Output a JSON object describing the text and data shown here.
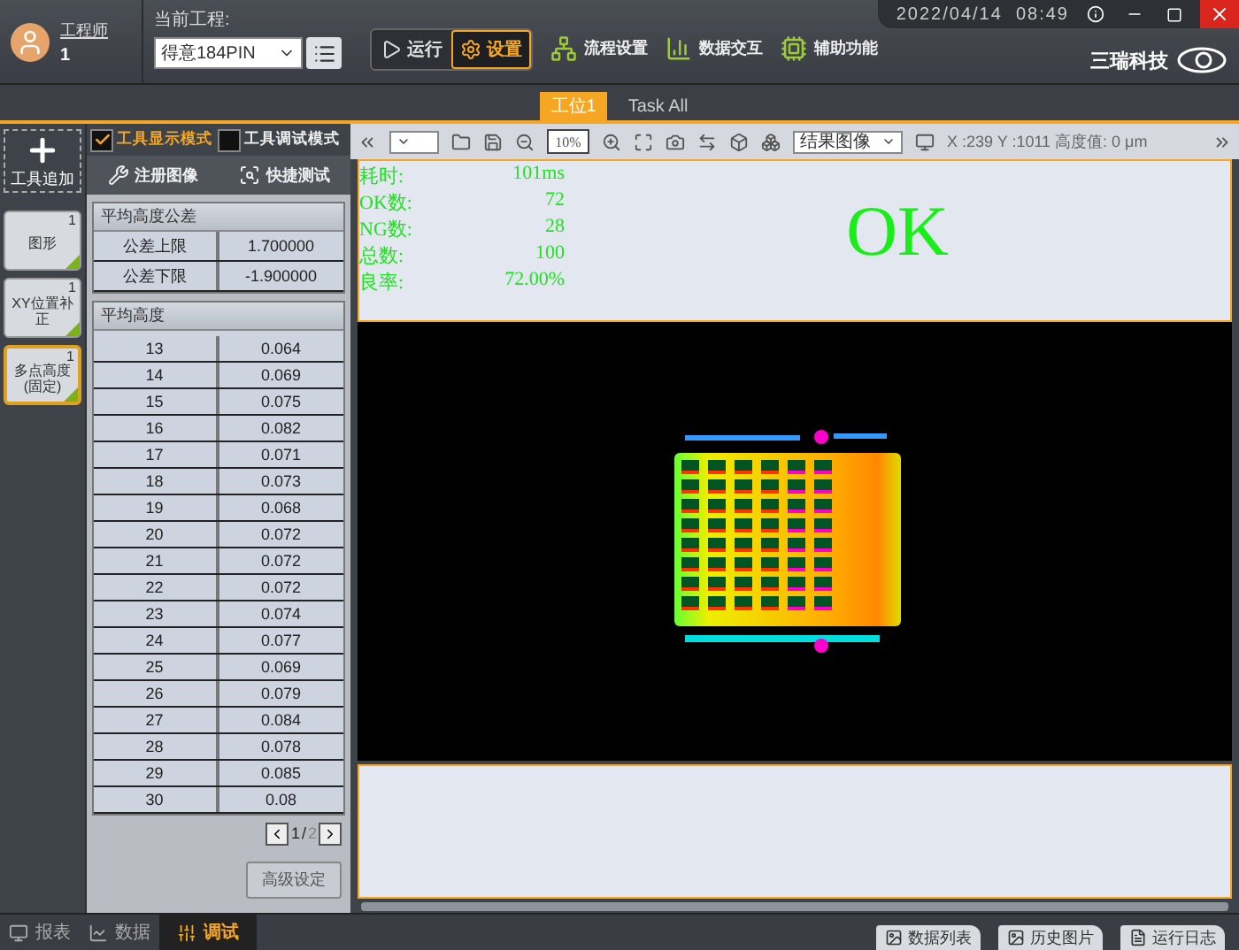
{
  "header": {
    "user": {
      "role": "工程师",
      "id": "1"
    },
    "project_label": "当前工程:",
    "project": "得意184PIN",
    "modes": [
      {
        "label": "运行",
        "selected": false
      },
      {
        "label": "设置",
        "selected": true
      }
    ],
    "menu": [
      "流程设置",
      "数据交互",
      "辅助功能"
    ],
    "datetime": "2022/04/14  08:49",
    "logo": "三瑞科技"
  },
  "station_tabs": [
    {
      "label": "工位1",
      "selected": true
    },
    {
      "label": "Task All",
      "selected": false
    }
  ],
  "tools": {
    "add": "工具追加",
    "items": [
      {
        "label": "图形",
        "count": "1",
        "selected": false
      },
      {
        "label": "XY位置补正",
        "count": "1",
        "selected": false
      },
      {
        "label": "多点高度(固定)",
        "count": "1",
        "selected": true
      }
    ]
  },
  "panel": {
    "modes": [
      {
        "label": "工具显示模式",
        "checked": true
      },
      {
        "label": "工具调试模式",
        "checked": false
      }
    ],
    "actions": [
      "注册图像",
      "快捷测试"
    ],
    "tolerance": {
      "title": "平均高度公差",
      "rows": [
        [
          "公差上限",
          "1.700000"
        ],
        [
          "公差下限",
          "-1.900000"
        ]
      ]
    },
    "heights": {
      "title": "平均高度",
      "rows": [
        [
          "13",
          "0.064"
        ],
        [
          "14",
          "0.069"
        ],
        [
          "15",
          "0.075"
        ],
        [
          "16",
          "0.082"
        ],
        [
          "17",
          "0.071"
        ],
        [
          "18",
          "0.073"
        ],
        [
          "19",
          "0.068"
        ],
        [
          "20",
          "0.072"
        ],
        [
          "21",
          "0.072"
        ],
        [
          "22",
          "0.072"
        ],
        [
          "23",
          "0.074"
        ],
        [
          "24",
          "0.077"
        ],
        [
          "25",
          "0.069"
        ],
        [
          "26",
          "0.079"
        ],
        [
          "27",
          "0.084"
        ],
        [
          "28",
          "0.078"
        ],
        [
          "29",
          "0.085"
        ],
        [
          "30",
          "0.08"
        ]
      ]
    },
    "pager": {
      "current": "1",
      "separator": "/",
      "total": "2"
    },
    "advanced": "高级设定"
  },
  "bottom_tabs": [
    {
      "label": "报表",
      "selected": false
    },
    {
      "label": "数据",
      "selected": false
    },
    {
      "label": "调试",
      "selected": true
    }
  ],
  "viewer": {
    "zoom": "10%",
    "image_select": "结果图像",
    "coords": "X :239 Y :1011 高度值: 0 μm",
    "stats": [
      {
        "label": "耗时:",
        "value": "101ms"
      },
      {
        "label": "OK数:",
        "value": "72"
      },
      {
        "label": "NG数:",
        "value": "28"
      },
      {
        "label": "总数:",
        "value": "100"
      },
      {
        "label": "良率:",
        "value": "72.00%"
      }
    ],
    "result": "OK"
  },
  "status_buttons": [
    "数据列表",
    "历史图片",
    "运行日志"
  ]
}
